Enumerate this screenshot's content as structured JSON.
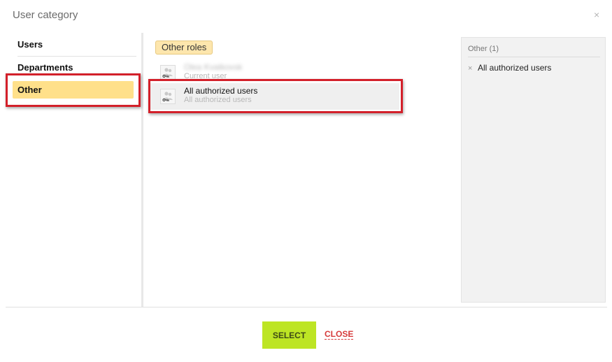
{
  "dialog": {
    "title": "User category",
    "close_glyph": "×"
  },
  "nav": {
    "items": [
      {
        "label": "Users"
      },
      {
        "label": "Departments"
      },
      {
        "label": "Other",
        "active": true
      }
    ]
  },
  "center": {
    "section_tag": "Other roles",
    "entities": [
      {
        "name": "Olea Kvatkovsk",
        "sub": "Current user",
        "icon": "user-key-icon"
      },
      {
        "name": "All authorized users",
        "sub": "All authorized users",
        "icon": "user-key-icon",
        "selected": true
      }
    ]
  },
  "right_panel": {
    "header": "Other (1)",
    "remove_glyph": "×",
    "selected": [
      "All authorized users"
    ]
  },
  "footer": {
    "select_label": "SELECT",
    "close_label": "CLOSE"
  },
  "colors": {
    "active_nav": "#ffe08a",
    "select_button": "#bde524",
    "close_link": "#d63a3a",
    "highlight": "#d3202a"
  }
}
